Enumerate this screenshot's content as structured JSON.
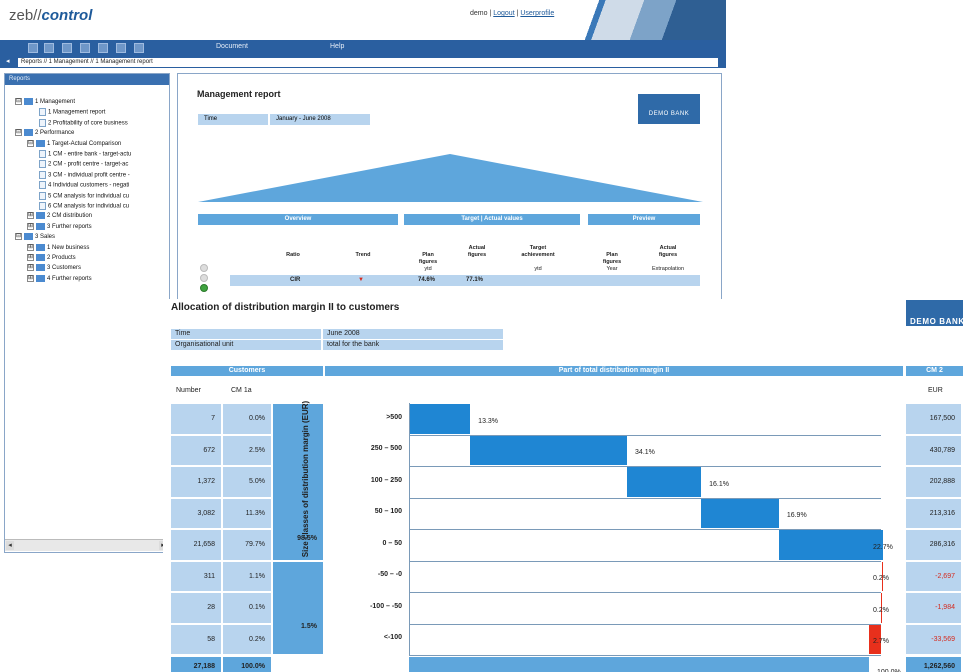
{
  "app": {
    "logo_part1": "zeb//",
    "logo_part2": "control",
    "user": "demo",
    "logout": "Logout",
    "userprofile": "Userprofile",
    "menu": [
      "Document",
      "Help"
    ],
    "breadcrumb": "Reports // 1 Management // 1 Management report"
  },
  "sidebar": {
    "title": "Reports",
    "items": [
      {
        "label": "1 Management",
        "kind": "folder",
        "expander": "⊟"
      },
      {
        "label": "1 Management report",
        "kind": "doc"
      },
      {
        "label": "2 Profitability of core business",
        "kind": "doc"
      },
      {
        "label": "2 Performance",
        "kind": "folder",
        "expander": "⊟"
      },
      {
        "label": "1 Target-Actual Comparison",
        "kind": "folder",
        "expander": "⊟"
      },
      {
        "label": "1 CM - entire bank - target-actu",
        "kind": "doc"
      },
      {
        "label": "2 CM - profit centre - target-ac",
        "kind": "doc"
      },
      {
        "label": "3 CM - individual profit centre -",
        "kind": "doc"
      },
      {
        "label": "4 Individual customers - negati",
        "kind": "doc"
      },
      {
        "label": "5 CM analysis for individual cu",
        "kind": "doc"
      },
      {
        "label": "6 CM analysis for individual cu",
        "kind": "doc"
      },
      {
        "label": "2 CM distribution",
        "kind": "folder",
        "expander": "⊞"
      },
      {
        "label": "3 Further reports",
        "kind": "folder",
        "expander": "⊞"
      },
      {
        "label": "3 Sales",
        "kind": "folder",
        "expander": "⊟"
      },
      {
        "label": "1 New business",
        "kind": "folder",
        "expander": "⊞"
      },
      {
        "label": "2 Products",
        "kind": "folder",
        "expander": "⊞"
      },
      {
        "label": "3 Customers",
        "kind": "folder",
        "expander": "⊞"
      },
      {
        "label": "4 Further reports",
        "kind": "folder",
        "expander": "⊞"
      }
    ]
  },
  "management_report": {
    "title": "Management report",
    "time_label": "Time",
    "time_value": "January - June 2008",
    "bank_logo": "DEMO BANK",
    "sections": [
      "Overview",
      "Target | Actual values",
      "Preview"
    ],
    "headers": {
      "ratio": "Ratio",
      "trend": "Trend",
      "plan": "Plan\nfigures",
      "actual": "Actual\nfigures",
      "target": "Target\nachievement",
      "p_plan": "Plan\nfigures",
      "p_actual": "Actual\nfigures"
    },
    "subheaders": {
      "plan": "ytd",
      "target": "ytd",
      "p_plan": "Year",
      "p_actual": "Extrapolation"
    },
    "row": {
      "ratio": "CIR",
      "plan": "74.6%",
      "actual": "77.1%"
    }
  },
  "allocation": {
    "title": "Allocation of distribution margin II to customers",
    "bank_logo": "DEMO BANK",
    "info": [
      {
        "label": "Time",
        "value": "June 2008"
      },
      {
        "label": "Organisational unit",
        "value": "total for the bank"
      }
    ],
    "sections": {
      "customers": "Customers",
      "part": "Part of total distribution margin II",
      "cm2": "CM 2"
    },
    "subheaders": {
      "number": "Number",
      "cm1a": "CM 1a",
      "eur": "EUR"
    },
    "axis_title": "Size classes of distribution margin (EUR)",
    "rows": [
      {
        "label": ">500",
        "number": "7",
        "share": "0.0%",
        "pct": "13.3%",
        "cm2": "167,500",
        "neg": false
      },
      {
        "label": "250 – 500",
        "number": "672",
        "share": "2.5%",
        "pct": "34.1%",
        "cm2": "430,789",
        "neg": false
      },
      {
        "label": "100 – 250",
        "number": "1,372",
        "share": "5.0%",
        "pct": "16.1%",
        "cm2": "202,888",
        "neg": false
      },
      {
        "label": "50 – 100",
        "number": "3,082",
        "share": "11.3%",
        "pct": "16.9%",
        "cm2": "213,316",
        "neg": false
      },
      {
        "label": "0 – 50",
        "number": "21,658",
        "share": "79.7%",
        "pct": "22.7%",
        "cm2": "286,316",
        "neg": false
      },
      {
        "label": "-50 – -0",
        "number": "311",
        "share": "1.1%",
        "pct": "0.2%",
        "cm2": "-2,697",
        "neg": true
      },
      {
        "label": "-100 – -50",
        "number": "28",
        "share": "0.1%",
        "pct": "0.2%",
        "cm2": "-1,984",
        "neg": true
      },
      {
        "label": "<-100",
        "number": "58",
        "share": "0.2%",
        "pct": "2.7%",
        "cm2": "-33,569",
        "neg": true
      }
    ],
    "positive_sum_share": "98.5%",
    "negative_sum_share": "1.5%",
    "total": {
      "number": "27,188",
      "share": "100.0%",
      "pct": "100.0%",
      "cm2": "1,262,560"
    },
    "colors": {
      "bar": "#1f86d3",
      "neg_bar": "#e8301c",
      "cell": "#b8d4ee",
      "header": "#5ea6dc"
    }
  },
  "chart_data": {
    "type": "bar",
    "title": "Allocation of distribution margin II to customers",
    "ylabel": "Size classes of distribution margin (EUR)",
    "categories": [
      ">500",
      "250 – 500",
      "100 – 250",
      "50 – 100",
      "0 – 50",
      "-50 – -0",
      "-100 – -50",
      "<-100"
    ],
    "values": [
      13.3,
      34.1,
      16.1,
      16.9,
      22.7,
      -0.2,
      -0.2,
      -2.7
    ],
    "total": 100.0,
    "unit": "%"
  }
}
